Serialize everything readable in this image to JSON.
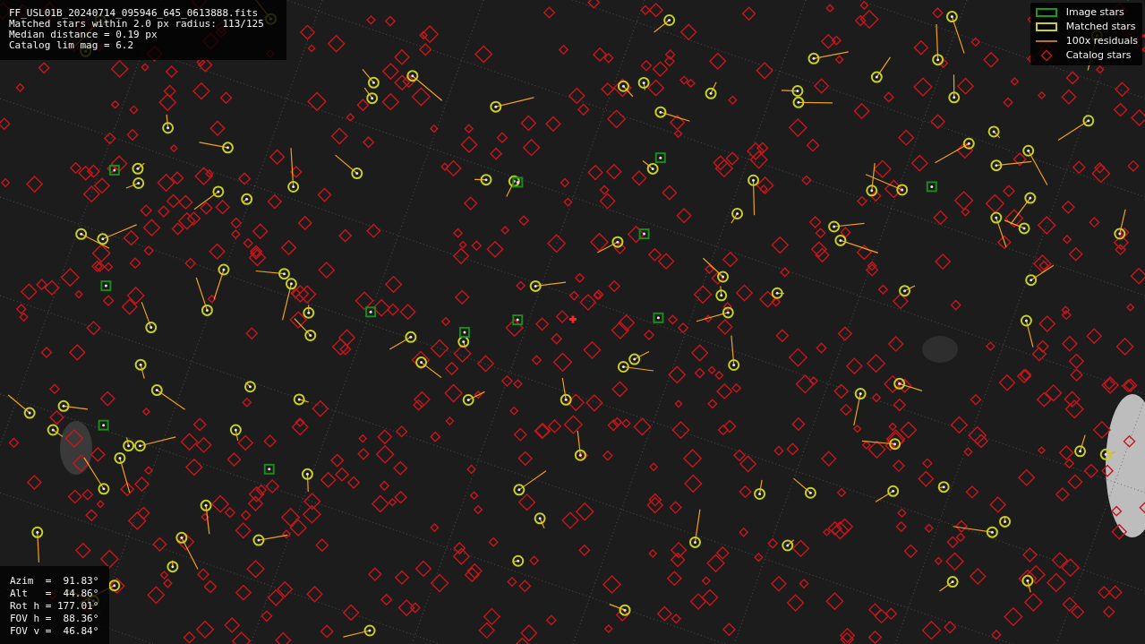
{
  "info": {
    "lines": [
      "FF_USL01B_20240714_095946_645_0613888.fits",
      "Matched stars within 2.0 px radius: 113/125",
      "Median distance = 0.19 px",
      "Catalog lim mag = 6.2"
    ]
  },
  "legend": [
    {
      "label": "Image stars",
      "kind": "image"
    },
    {
      "label": "Matched stars",
      "kind": "matched"
    },
    {
      "label": "100x residuals",
      "kind": "residual"
    },
    {
      "label": "Catalog stars",
      "kind": "catalog"
    }
  ],
  "pointing": [
    "Azim  =  91.83°",
    "Alt   =  44.86°",
    "Rot h = 177.01°",
    "FOV h =  88.36°",
    "FOV v =  46.84°"
  ]
}
